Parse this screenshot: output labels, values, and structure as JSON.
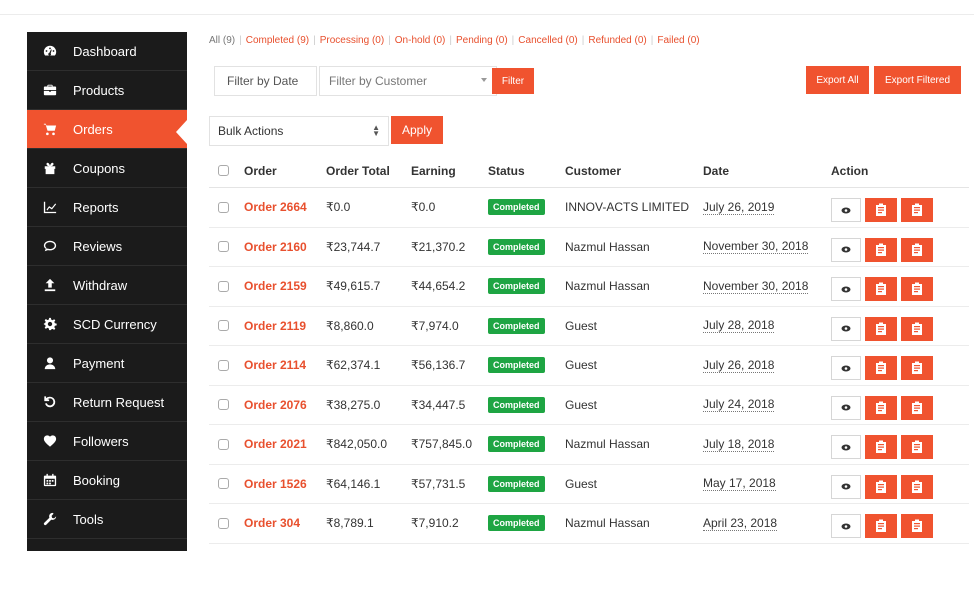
{
  "sidebar": {
    "items": [
      {
        "label": "Dashboard",
        "icon": "dashboard-icon"
      },
      {
        "label": "Products",
        "icon": "briefcase-icon"
      },
      {
        "label": "Orders",
        "icon": "cart-icon",
        "active": true
      },
      {
        "label": "Coupons",
        "icon": "gift-icon"
      },
      {
        "label": "Reports",
        "icon": "chart-line-icon"
      },
      {
        "label": "Reviews",
        "icon": "comments-icon"
      },
      {
        "label": "Withdraw",
        "icon": "upload-icon"
      },
      {
        "label": "SCD Currency",
        "icon": "gear-icon"
      },
      {
        "label": "Payment",
        "icon": "user-icon"
      },
      {
        "label": "Return Request",
        "icon": "undo-icon"
      },
      {
        "label": "Followers",
        "icon": "heart-icon"
      },
      {
        "label": "Booking",
        "icon": "calendar-icon"
      },
      {
        "label": "Tools",
        "icon": "wrench-icon"
      }
    ]
  },
  "status_filter": [
    "All (9)",
    "Completed (9)",
    "Processing (0)",
    "On-hold (0)",
    "Pending (0)",
    "Cancelled (0)",
    "Refunded (0)",
    "Failed (0)"
  ],
  "filters": {
    "date_placeholder": "Filter by Date",
    "customer_placeholder": "Filter by Customer",
    "filter_label": "Filter",
    "export_all_label": "Export All",
    "export_filtered_label": "Export Filtered"
  },
  "bulk": {
    "selected": "Bulk Actions",
    "apply_label": "Apply"
  },
  "table": {
    "headers": {
      "order": "Order",
      "total": "Order Total",
      "earning": "Earning",
      "status": "Status",
      "customer": "Customer",
      "date": "Date",
      "action": "Action"
    },
    "rows": [
      {
        "order": "Order 2664",
        "total": "₹0.0",
        "earning": "₹0.0",
        "status": "Completed",
        "customer": "INNOV-ACTS LIMITED",
        "date": "July 26, 2019"
      },
      {
        "order": "Order 2160",
        "total": "₹23,744.7",
        "earning": "₹21,370.2",
        "status": "Completed",
        "customer": "Nazmul Hassan",
        "date": "November 30, 2018"
      },
      {
        "order": "Order 2159",
        "total": "₹49,615.7",
        "earning": "₹44,654.2",
        "status": "Completed",
        "customer": "Nazmul Hassan",
        "date": "November 30, 2018"
      },
      {
        "order": "Order 2119",
        "total": "₹8,860.0",
        "earning": "₹7,974.0",
        "status": "Completed",
        "customer": "Guest",
        "date": "July 28, 2018"
      },
      {
        "order": "Order 2114",
        "total": "₹62,374.1",
        "earning": "₹56,136.7",
        "status": "Completed",
        "customer": "Guest",
        "date": "July 26, 2018"
      },
      {
        "order": "Order 2076",
        "total": "₹38,275.0",
        "earning": "₹34,447.5",
        "status": "Completed",
        "customer": "Guest",
        "date": "July 24, 2018"
      },
      {
        "order": "Order 2021",
        "total": "₹842,050.0",
        "earning": "₹757,845.0",
        "status": "Completed",
        "customer": "Nazmul Hassan",
        "date": "July 18, 2018"
      },
      {
        "order": "Order 1526",
        "total": "₹64,146.1",
        "earning": "₹57,731.5",
        "status": "Completed",
        "customer": "Guest",
        "date": "May 17, 2018"
      },
      {
        "order": "Order 304",
        "total": "₹8,789.1",
        "earning": "₹7,910.2",
        "status": "Completed",
        "customer": "Nazmul Hassan",
        "date": "April 23, 2018"
      }
    ]
  },
  "colors": {
    "accent": "#f0532f",
    "sidebar_bg": "#1b1b1b",
    "status_completed": "#1ea543"
  }
}
